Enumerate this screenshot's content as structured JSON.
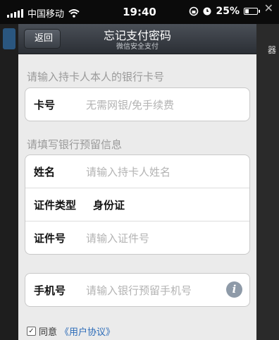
{
  "status_bar": {
    "carrier": "中国移动",
    "time": "19:40",
    "battery": "25%",
    "battery_level": 0.25
  },
  "background": {
    "right_text": "器"
  },
  "nav": {
    "back_label": "返回",
    "title": "忘记支付密码",
    "subtitle": "微信安全支付"
  },
  "card_section": {
    "label": "请输入持卡人本人的银行卡号",
    "card_row": {
      "label": "卡号",
      "placeholder": "无需网银/免手续费"
    }
  },
  "info_section": {
    "label": "请填写银行预留信息",
    "name_row": {
      "label": "姓名",
      "placeholder": "请输入持卡人姓名"
    },
    "id_type_row": {
      "label": "证件类型",
      "value": "身份证"
    },
    "id_number_row": {
      "label": "证件号",
      "placeholder": "请输入证件号"
    }
  },
  "phone_row": {
    "label": "手机号",
    "placeholder": "请输入银行预留手机号"
  },
  "agreement": {
    "checked": true,
    "prefix": "同意",
    "link": "《用户协议》"
  }
}
